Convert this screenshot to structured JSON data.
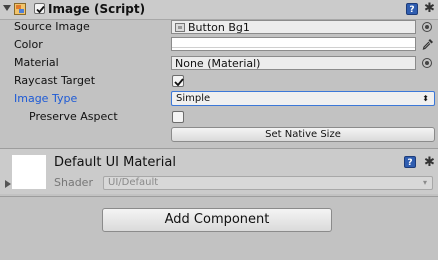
{
  "component": {
    "title": "Image (Script)",
    "enabled": true,
    "help_glyph": "?",
    "icons": [
      "component-icon",
      "help-icon",
      "gear-icon"
    ]
  },
  "properties": {
    "source_image": {
      "label": "Source Image",
      "value": "Button Bg1"
    },
    "color": {
      "label": "Color",
      "value": "#ffffff"
    },
    "material": {
      "label": "Material",
      "value": "None (Material)"
    },
    "raycast_target": {
      "label": "Raycast Target",
      "checked": true
    },
    "image_type": {
      "label": "Image Type",
      "value": "Simple",
      "arrow": "⬍"
    },
    "preserve_aspect": {
      "label": "Preserve Aspect",
      "checked": false
    },
    "set_native_size": {
      "label": "Set Native Size"
    }
  },
  "material_panel": {
    "name": "Default UI Material",
    "shader_label": "Shader",
    "shader_value": "UI/Default",
    "help_glyph": "?",
    "arrow": "▾"
  },
  "add_component": {
    "label": "Add Component"
  },
  "colors": {
    "label_highlight": "#1d5ad6",
    "dropdown_border": "#3c78d8",
    "panel_bg": "#c2c2c2"
  }
}
